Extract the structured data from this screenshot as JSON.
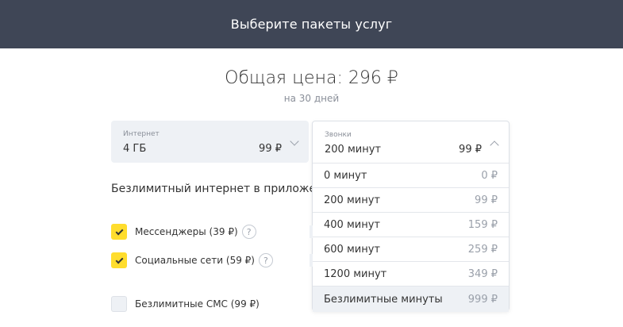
{
  "header": {
    "title": "Выберите пакеты услуг"
  },
  "summary": {
    "total": "Общая цена: 296 ₽",
    "period": "на 30 дней"
  },
  "internet": {
    "caption": "Интернет",
    "value": "4 ГБ",
    "price": "99 ₽"
  },
  "calls": {
    "caption": "Звонки",
    "value": "200 минут",
    "price": "99 ₽",
    "options": [
      {
        "label": "0 минут",
        "price": "0 ₽"
      },
      {
        "label": "200 минут",
        "price": "99 ₽"
      },
      {
        "label": "400 минут",
        "price": "159 ₽"
      },
      {
        "label": "600 минут",
        "price": "259 ₽"
      },
      {
        "label": "1200 минут",
        "price": "349 ₽"
      },
      {
        "label": "Безлимитные минуты",
        "price": "999 ₽"
      }
    ]
  },
  "apps": {
    "title": "Безлимитный интернет в приложениях",
    "items": [
      {
        "label": "Мессенджеры (39 ₽)",
        "checked": true
      },
      {
        "label": "Социальные сети (59 ₽)",
        "checked": true
      }
    ]
  },
  "sms": {
    "label": "Безлимитные СМС (99 ₽)",
    "checked": false
  },
  "colors": {
    "header_bg": "#3f4656",
    "accent": "#ffdd2d",
    "field_bg": "#eef1f5"
  }
}
